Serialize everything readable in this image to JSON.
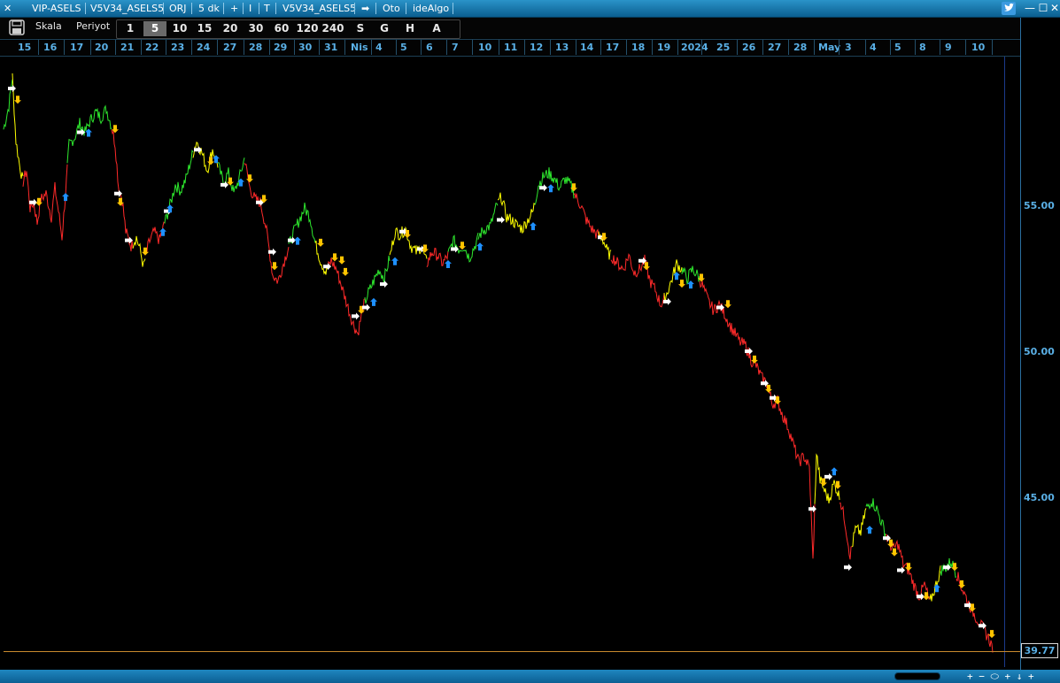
{
  "titlebar": {
    "items": [
      "VIP-ASELS",
      "V5V34_ASELS5",
      "ORJ",
      "5 dk",
      "+",
      "I",
      "T",
      "V5V34_ASELS5",
      "➡",
      "Oto",
      "ideAlgo"
    ],
    "close_glyph": "✕",
    "win_buttons": [
      "—",
      "☐",
      "✕"
    ]
  },
  "toolbar": {
    "scale_label": "Skala",
    "period_label": "Periyot",
    "periods": [
      "1",
      "5",
      "10",
      "15",
      "20",
      "30",
      "60",
      "120",
      "240",
      "S",
      "G",
      "H",
      "A"
    ],
    "active_period": "5"
  },
  "date_axis": {
    "ticks": [
      "15",
      "16",
      "17",
      "20",
      "21",
      "22",
      "23",
      "24",
      "27",
      "28",
      "29",
      "30",
      "31",
      "Nis",
      "4",
      "5",
      "6",
      "7",
      "10",
      "11",
      "12",
      "13",
      "14",
      "17",
      "18",
      "19",
      "2024",
      "25",
      "26",
      "27",
      "28",
      "May",
      "3",
      "4",
      "5",
      "8",
      "9",
      "10"
    ]
  },
  "price_axis": {
    "labels": [
      "55.00",
      "50.00",
      "45.00"
    ],
    "last_price": "39.77"
  },
  "status_controls": "+ − ⬭ + ↓ +",
  "colors": {
    "up": "#2ee82e",
    "neutral": "#ffff00",
    "down": "#ff2a2a",
    "arrow_white": "#ffffff",
    "arrow_gold": "#ffc400",
    "arrow_blue": "#1e90ff",
    "accent": "#1a78b4",
    "axis_text": "#5ab0e6"
  },
  "chart_data": {
    "type": "line",
    "symbol": "VIP-ASELS",
    "ylim": [
      39.0,
      60.5
    ],
    "path": [
      [
        4,
        57.6
      ],
      [
        10,
        58.4
      ],
      [
        14,
        59.4
      ],
      [
        18,
        57.2
      ],
      [
        22,
        56.4
      ],
      [
        26,
        55.8
      ],
      [
        30,
        56.2
      ],
      [
        34,
        54.9
      ],
      [
        38,
        55.1
      ],
      [
        42,
        54.4
      ],
      [
        46,
        55.2
      ],
      [
        52,
        55.4
      ],
      [
        58,
        54.6
      ],
      [
        62,
        55.6
      ],
      [
        66,
        54.8
      ],
      [
        70,
        53.9
      ],
      [
        74,
        55.4
      ],
      [
        78,
        57.1
      ],
      [
        84,
        57.3
      ],
      [
        90,
        57.8
      ],
      [
        96,
        57.5
      ],
      [
        102,
        57.9
      ],
      [
        108,
        58.2
      ],
      [
        114,
        58.0
      ],
      [
        120,
        58.3
      ],
      [
        126,
        57.7
      ],
      [
        130,
        57.1
      ],
      [
        134,
        55.6
      ],
      [
        138,
        55.2
      ],
      [
        142,
        54.1
      ],
      [
        148,
        53.6
      ],
      [
        154,
        53.9
      ],
      [
        158,
        53.5
      ],
      [
        162,
        52.9
      ],
      [
        168,
        53.7
      ],
      [
        174,
        54.1
      ],
      [
        180,
        53.8
      ],
      [
        186,
        54.4
      ],
      [
        192,
        55.0
      ],
      [
        198,
        55.7
      ],
      [
        204,
        55.5
      ],
      [
        210,
        55.9
      ],
      [
        216,
        56.6
      ],
      [
        222,
        57.2
      ],
      [
        228,
        56.8
      ],
      [
        234,
        56.2
      ],
      [
        240,
        56.9
      ],
      [
        246,
        56.4
      ],
      [
        252,
        55.8
      ],
      [
        258,
        56.1
      ],
      [
        264,
        55.4
      ],
      [
        270,
        55.9
      ],
      [
        276,
        56.6
      ],
      [
        282,
        55.6
      ],
      [
        288,
        55.2
      ],
      [
        294,
        55.1
      ],
      [
        300,
        54.3
      ],
      [
        304,
        53.5
      ],
      [
        308,
        52.6
      ],
      [
        314,
        52.4
      ],
      [
        320,
        53.0
      ],
      [
        326,
        53.6
      ],
      [
        332,
        54.1
      ],
      [
        338,
        54.5
      ],
      [
        344,
        54.9
      ],
      [
        350,
        54.6
      ],
      [
        356,
        53.7
      ],
      [
        362,
        53.1
      ],
      [
        368,
        52.7
      ],
      [
        374,
        53.1
      ],
      [
        380,
        52.8
      ],
      [
        386,
        52.2
      ],
      [
        392,
        51.6
      ],
      [
        398,
        51.0
      ],
      [
        404,
        50.6
      ],
      [
        410,
        51.5
      ],
      [
        416,
        52.0
      ],
      [
        422,
        52.4
      ],
      [
        428,
        52.8
      ],
      [
        434,
        52.5
      ],
      [
        440,
        53.2
      ],
      [
        446,
        54.1
      ],
      [
        452,
        54.0
      ],
      [
        458,
        54.2
      ],
      [
        464,
        53.6
      ],
      [
        470,
        53.4
      ],
      [
        476,
        53.6
      ],
      [
        482,
        53.0
      ],
      [
        488,
        53.4
      ],
      [
        494,
        53.3
      ],
      [
        500,
        53.0
      ],
      [
        506,
        53.3
      ],
      [
        512,
        53.8
      ],
      [
        518,
        53.5
      ],
      [
        524,
        53.6
      ],
      [
        530,
        53.2
      ],
      [
        536,
        53.6
      ],
      [
        542,
        54.0
      ],
      [
        548,
        54.2
      ],
      [
        554,
        54.3
      ],
      [
        560,
        54.9
      ],
      [
        566,
        55.3
      ],
      [
        572,
        54.6
      ],
      [
        578,
        54.5
      ],
      [
        584,
        54.3
      ],
      [
        590,
        54.2
      ],
      [
        596,
        54.5
      ],
      [
        602,
        54.8
      ],
      [
        608,
        55.7
      ],
      [
        614,
        56.0
      ],
      [
        620,
        56.1
      ],
      [
        626,
        55.9
      ],
      [
        632,
        55.6
      ],
      [
        638,
        55.9
      ],
      [
        644,
        55.7
      ],
      [
        650,
        55.3
      ],
      [
        656,
        55.0
      ],
      [
        662,
        54.5
      ],
      [
        668,
        54.2
      ],
      [
        674,
        54.0
      ],
      [
        680,
        53.9
      ],
      [
        686,
        53.4
      ],
      [
        692,
        53.2
      ],
      [
        698,
        53.0
      ],
      [
        704,
        52.8
      ],
      [
        710,
        53.3
      ],
      [
        716,
        52.7
      ],
      [
        722,
        52.8
      ],
      [
        728,
        53.1
      ],
      [
        734,
        52.4
      ],
      [
        740,
        52.1
      ],
      [
        746,
        51.6
      ],
      [
        752,
        51.9
      ],
      [
        758,
        52.4
      ],
      [
        764,
        53.0
      ],
      [
        770,
        52.8
      ],
      [
        776,
        52.5
      ],
      [
        782,
        52.8
      ],
      [
        788,
        52.6
      ],
      [
        794,
        52.2
      ],
      [
        800,
        51.7
      ],
      [
        806,
        51.4
      ],
      [
        812,
        51.6
      ],
      [
        818,
        51.3
      ],
      [
        824,
        50.9
      ],
      [
        830,
        50.6
      ],
      [
        836,
        50.3
      ],
      [
        842,
        50.2
      ],
      [
        848,
        49.7
      ],
      [
        854,
        49.5
      ],
      [
        860,
        49.1
      ],
      [
        866,
        48.9
      ],
      [
        872,
        48.2
      ],
      [
        878,
        48.3
      ],
      [
        884,
        47.8
      ],
      [
        890,
        47.4
      ],
      [
        896,
        46.8
      ],
      [
        902,
        46.2
      ],
      [
        908,
        46.4
      ],
      [
        914,
        46.0
      ],
      [
        918,
        42.8
      ],
      [
        922,
        46.5
      ],
      [
        926,
        45.6
      ],
      [
        930,
        45.3
      ],
      [
        936,
        44.9
      ],
      [
        942,
        45.5
      ],
      [
        948,
        45.0
      ],
      [
        954,
        44.2
      ],
      [
        960,
        43.0
      ],
      [
        966,
        43.9
      ],
      [
        972,
        43.8
      ],
      [
        978,
        44.6
      ],
      [
        984,
        44.9
      ],
      [
        990,
        44.6
      ],
      [
        996,
        44.1
      ],
      [
        1002,
        43.6
      ],
      [
        1008,
        43.2
      ],
      [
        1014,
        43.4
      ],
      [
        1020,
        42.7
      ],
      [
        1026,
        42.5
      ],
      [
        1032,
        42.0
      ],
      [
        1038,
        41.6
      ],
      [
        1044,
        42.0
      ],
      [
        1050,
        41.4
      ],
      [
        1056,
        41.9
      ],
      [
        1062,
        42.5
      ],
      [
        1068,
        42.6
      ],
      [
        1074,
        42.8
      ],
      [
        1080,
        42.4
      ],
      [
        1086,
        41.9
      ],
      [
        1092,
        41.5
      ],
      [
        1098,
        41.1
      ],
      [
        1104,
        40.8
      ],
      [
        1110,
        40.5
      ],
      [
        1116,
        40.2
      ],
      [
        1122,
        39.77
      ]
    ],
    "segments": [
      {
        "from": 4,
        "to": 14,
        "trend": "up"
      },
      {
        "from": 14,
        "to": 26,
        "trend": "neutral"
      },
      {
        "from": 26,
        "to": 76,
        "trend": "down"
      },
      {
        "from": 76,
        "to": 126,
        "trend": "up"
      },
      {
        "from": 126,
        "to": 150,
        "trend": "down"
      },
      {
        "from": 150,
        "to": 164,
        "trend": "neutral"
      },
      {
        "from": 164,
        "to": 186,
        "trend": "down"
      },
      {
        "from": 186,
        "to": 218,
        "trend": "up"
      },
      {
        "from": 218,
        "to": 246,
        "trend": "neutral"
      },
      {
        "from": 246,
        "to": 276,
        "trend": "up"
      },
      {
        "from": 276,
        "to": 326,
        "trend": "down"
      },
      {
        "from": 326,
        "to": 356,
        "trend": "up"
      },
      {
        "from": 356,
        "to": 370,
        "trend": "neutral"
      },
      {
        "from": 370,
        "to": 412,
        "trend": "down"
      },
      {
        "from": 412,
        "to": 440,
        "trend": "up"
      },
      {
        "from": 440,
        "to": 482,
        "trend": "neutral"
      },
      {
        "from": 482,
        "to": 506,
        "trend": "down"
      },
      {
        "from": 506,
        "to": 540,
        "trend": "up"
      },
      {
        "from": 540,
        "to": 562,
        "trend": "up"
      },
      {
        "from": 562,
        "to": 604,
        "trend": "neutral"
      },
      {
        "from": 604,
        "to": 648,
        "trend": "up"
      },
      {
        "from": 648,
        "to": 676,
        "trend": "down"
      },
      {
        "from": 676,
        "to": 690,
        "trend": "neutral"
      },
      {
        "from": 690,
        "to": 750,
        "trend": "down"
      },
      {
        "from": 750,
        "to": 770,
        "trend": "neutral"
      },
      {
        "from": 770,
        "to": 790,
        "trend": "up"
      },
      {
        "from": 790,
        "to": 920,
        "trend": "down"
      },
      {
        "from": 920,
        "to": 948,
        "trend": "neutral"
      },
      {
        "from": 948,
        "to": 962,
        "trend": "down"
      },
      {
        "from": 962,
        "to": 978,
        "trend": "neutral"
      },
      {
        "from": 978,
        "to": 1000,
        "trend": "up"
      },
      {
        "from": 1000,
        "to": 1050,
        "trend": "down"
      },
      {
        "from": 1050,
        "to": 1062,
        "trend": "neutral"
      },
      {
        "from": 1062,
        "to": 1080,
        "trend": "up"
      },
      {
        "from": 1080,
        "to": 1122,
        "trend": "down"
      }
    ],
    "signals": [
      {
        "x": 14,
        "y": 59.0,
        "kind": "right"
      },
      {
        "x": 20,
        "y": 58.6,
        "kind": "down"
      },
      {
        "x": 38,
        "y": 55.1,
        "kind": "right"
      },
      {
        "x": 44,
        "y": 55.1,
        "kind": "down"
      },
      {
        "x": 74,
        "y": 55.3,
        "kind": "up"
      },
      {
        "x": 92,
        "y": 57.5,
        "kind": "right"
      },
      {
        "x": 100,
        "y": 57.5,
        "kind": "up"
      },
      {
        "x": 130,
        "y": 57.6,
        "kind": "down"
      },
      {
        "x": 134,
        "y": 55.4,
        "kind": "right"
      },
      {
        "x": 136,
        "y": 55.1,
        "kind": "down"
      },
      {
        "x": 146,
        "y": 53.8,
        "kind": "right"
      },
      {
        "x": 164,
        "y": 53.4,
        "kind": "down"
      },
      {
        "x": 184,
        "y": 54.1,
        "kind": "up"
      },
      {
        "x": 190,
        "y": 54.8,
        "kind": "right"
      },
      {
        "x": 192,
        "y": 54.9,
        "kind": "up"
      },
      {
        "x": 224,
        "y": 56.9,
        "kind": "right"
      },
      {
        "x": 238,
        "y": 56.5,
        "kind": "down"
      },
      {
        "x": 244,
        "y": 56.6,
        "kind": "up"
      },
      {
        "x": 254,
        "y": 55.7,
        "kind": "right"
      },
      {
        "x": 260,
        "y": 55.8,
        "kind": "down"
      },
      {
        "x": 272,
        "y": 55.8,
        "kind": "up"
      },
      {
        "x": 282,
        "y": 55.9,
        "kind": "down"
      },
      {
        "x": 294,
        "y": 55.1,
        "kind": "right"
      },
      {
        "x": 298,
        "y": 55.2,
        "kind": "down"
      },
      {
        "x": 308,
        "y": 53.4,
        "kind": "right"
      },
      {
        "x": 310,
        "y": 52.9,
        "kind": "down"
      },
      {
        "x": 330,
        "y": 53.8,
        "kind": "right"
      },
      {
        "x": 336,
        "y": 53.8,
        "kind": "up"
      },
      {
        "x": 362,
        "y": 53.7,
        "kind": "down"
      },
      {
        "x": 370,
        "y": 52.9,
        "kind": "right"
      },
      {
        "x": 378,
        "y": 53.2,
        "kind": "down"
      },
      {
        "x": 386,
        "y": 53.1,
        "kind": "down"
      },
      {
        "x": 390,
        "y": 52.7,
        "kind": "down"
      },
      {
        "x": 402,
        "y": 51.2,
        "kind": "right"
      },
      {
        "x": 408,
        "y": 51.4,
        "kind": "down"
      },
      {
        "x": 414,
        "y": 51.5,
        "kind": "right"
      },
      {
        "x": 422,
        "y": 51.7,
        "kind": "up"
      },
      {
        "x": 434,
        "y": 52.3,
        "kind": "right"
      },
      {
        "x": 446,
        "y": 53.1,
        "kind": "up"
      },
      {
        "x": 456,
        "y": 54.1,
        "kind": "right"
      },
      {
        "x": 460,
        "y": 54.0,
        "kind": "down"
      },
      {
        "x": 476,
        "y": 53.5,
        "kind": "right"
      },
      {
        "x": 480,
        "y": 53.5,
        "kind": "down"
      },
      {
        "x": 506,
        "y": 53.0,
        "kind": "up"
      },
      {
        "x": 514,
        "y": 53.5,
        "kind": "right"
      },
      {
        "x": 522,
        "y": 53.6,
        "kind": "down"
      },
      {
        "x": 542,
        "y": 53.6,
        "kind": "up"
      },
      {
        "x": 566,
        "y": 54.5,
        "kind": "right"
      },
      {
        "x": 602,
        "y": 54.3,
        "kind": "up"
      },
      {
        "x": 614,
        "y": 55.6,
        "kind": "right"
      },
      {
        "x": 622,
        "y": 55.6,
        "kind": "up"
      },
      {
        "x": 648,
        "y": 55.6,
        "kind": "down"
      },
      {
        "x": 680,
        "y": 53.9,
        "kind": "right"
      },
      {
        "x": 682,
        "y": 53.9,
        "kind": "down"
      },
      {
        "x": 726,
        "y": 53.1,
        "kind": "right"
      },
      {
        "x": 730,
        "y": 52.9,
        "kind": "down"
      },
      {
        "x": 754,
        "y": 51.7,
        "kind": "right"
      },
      {
        "x": 764,
        "y": 52.6,
        "kind": "up"
      },
      {
        "x": 770,
        "y": 52.3,
        "kind": "down"
      },
      {
        "x": 780,
        "y": 52.3,
        "kind": "up"
      },
      {
        "x": 792,
        "y": 52.5,
        "kind": "down"
      },
      {
        "x": 814,
        "y": 51.5,
        "kind": "right"
      },
      {
        "x": 822,
        "y": 51.6,
        "kind": "down"
      },
      {
        "x": 846,
        "y": 50.0,
        "kind": "right"
      },
      {
        "x": 852,
        "y": 49.7,
        "kind": "down"
      },
      {
        "x": 864,
        "y": 48.9,
        "kind": "right"
      },
      {
        "x": 868,
        "y": 48.7,
        "kind": "down"
      },
      {
        "x": 874,
        "y": 48.4,
        "kind": "right"
      },
      {
        "x": 878,
        "y": 48.3,
        "kind": "down"
      },
      {
        "x": 918,
        "y": 44.6,
        "kind": "right"
      },
      {
        "x": 930,
        "y": 45.5,
        "kind": "down"
      },
      {
        "x": 936,
        "y": 45.7,
        "kind": "right"
      },
      {
        "x": 942,
        "y": 45.9,
        "kind": "up"
      },
      {
        "x": 946,
        "y": 45.4,
        "kind": "down"
      },
      {
        "x": 958,
        "y": 42.6,
        "kind": "right"
      },
      {
        "x": 982,
        "y": 43.9,
        "kind": "up"
      },
      {
        "x": 1002,
        "y": 43.6,
        "kind": "right"
      },
      {
        "x": 1006,
        "y": 43.4,
        "kind": "down"
      },
      {
        "x": 1010,
        "y": 43.1,
        "kind": "down"
      },
      {
        "x": 1018,
        "y": 42.5,
        "kind": "right"
      },
      {
        "x": 1026,
        "y": 42.6,
        "kind": "down"
      },
      {
        "x": 1040,
        "y": 41.6,
        "kind": "right"
      },
      {
        "x": 1046,
        "y": 41.6,
        "kind": "down"
      },
      {
        "x": 1058,
        "y": 41.9,
        "kind": "up"
      },
      {
        "x": 1070,
        "y": 42.6,
        "kind": "right"
      },
      {
        "x": 1078,
        "y": 42.6,
        "kind": "down"
      },
      {
        "x": 1086,
        "y": 42.0,
        "kind": "down"
      },
      {
        "x": 1094,
        "y": 41.3,
        "kind": "right"
      },
      {
        "x": 1098,
        "y": 41.2,
        "kind": "down"
      },
      {
        "x": 1110,
        "y": 40.6,
        "kind": "right"
      },
      {
        "x": 1120,
        "y": 40.3,
        "kind": "down"
      }
    ]
  }
}
